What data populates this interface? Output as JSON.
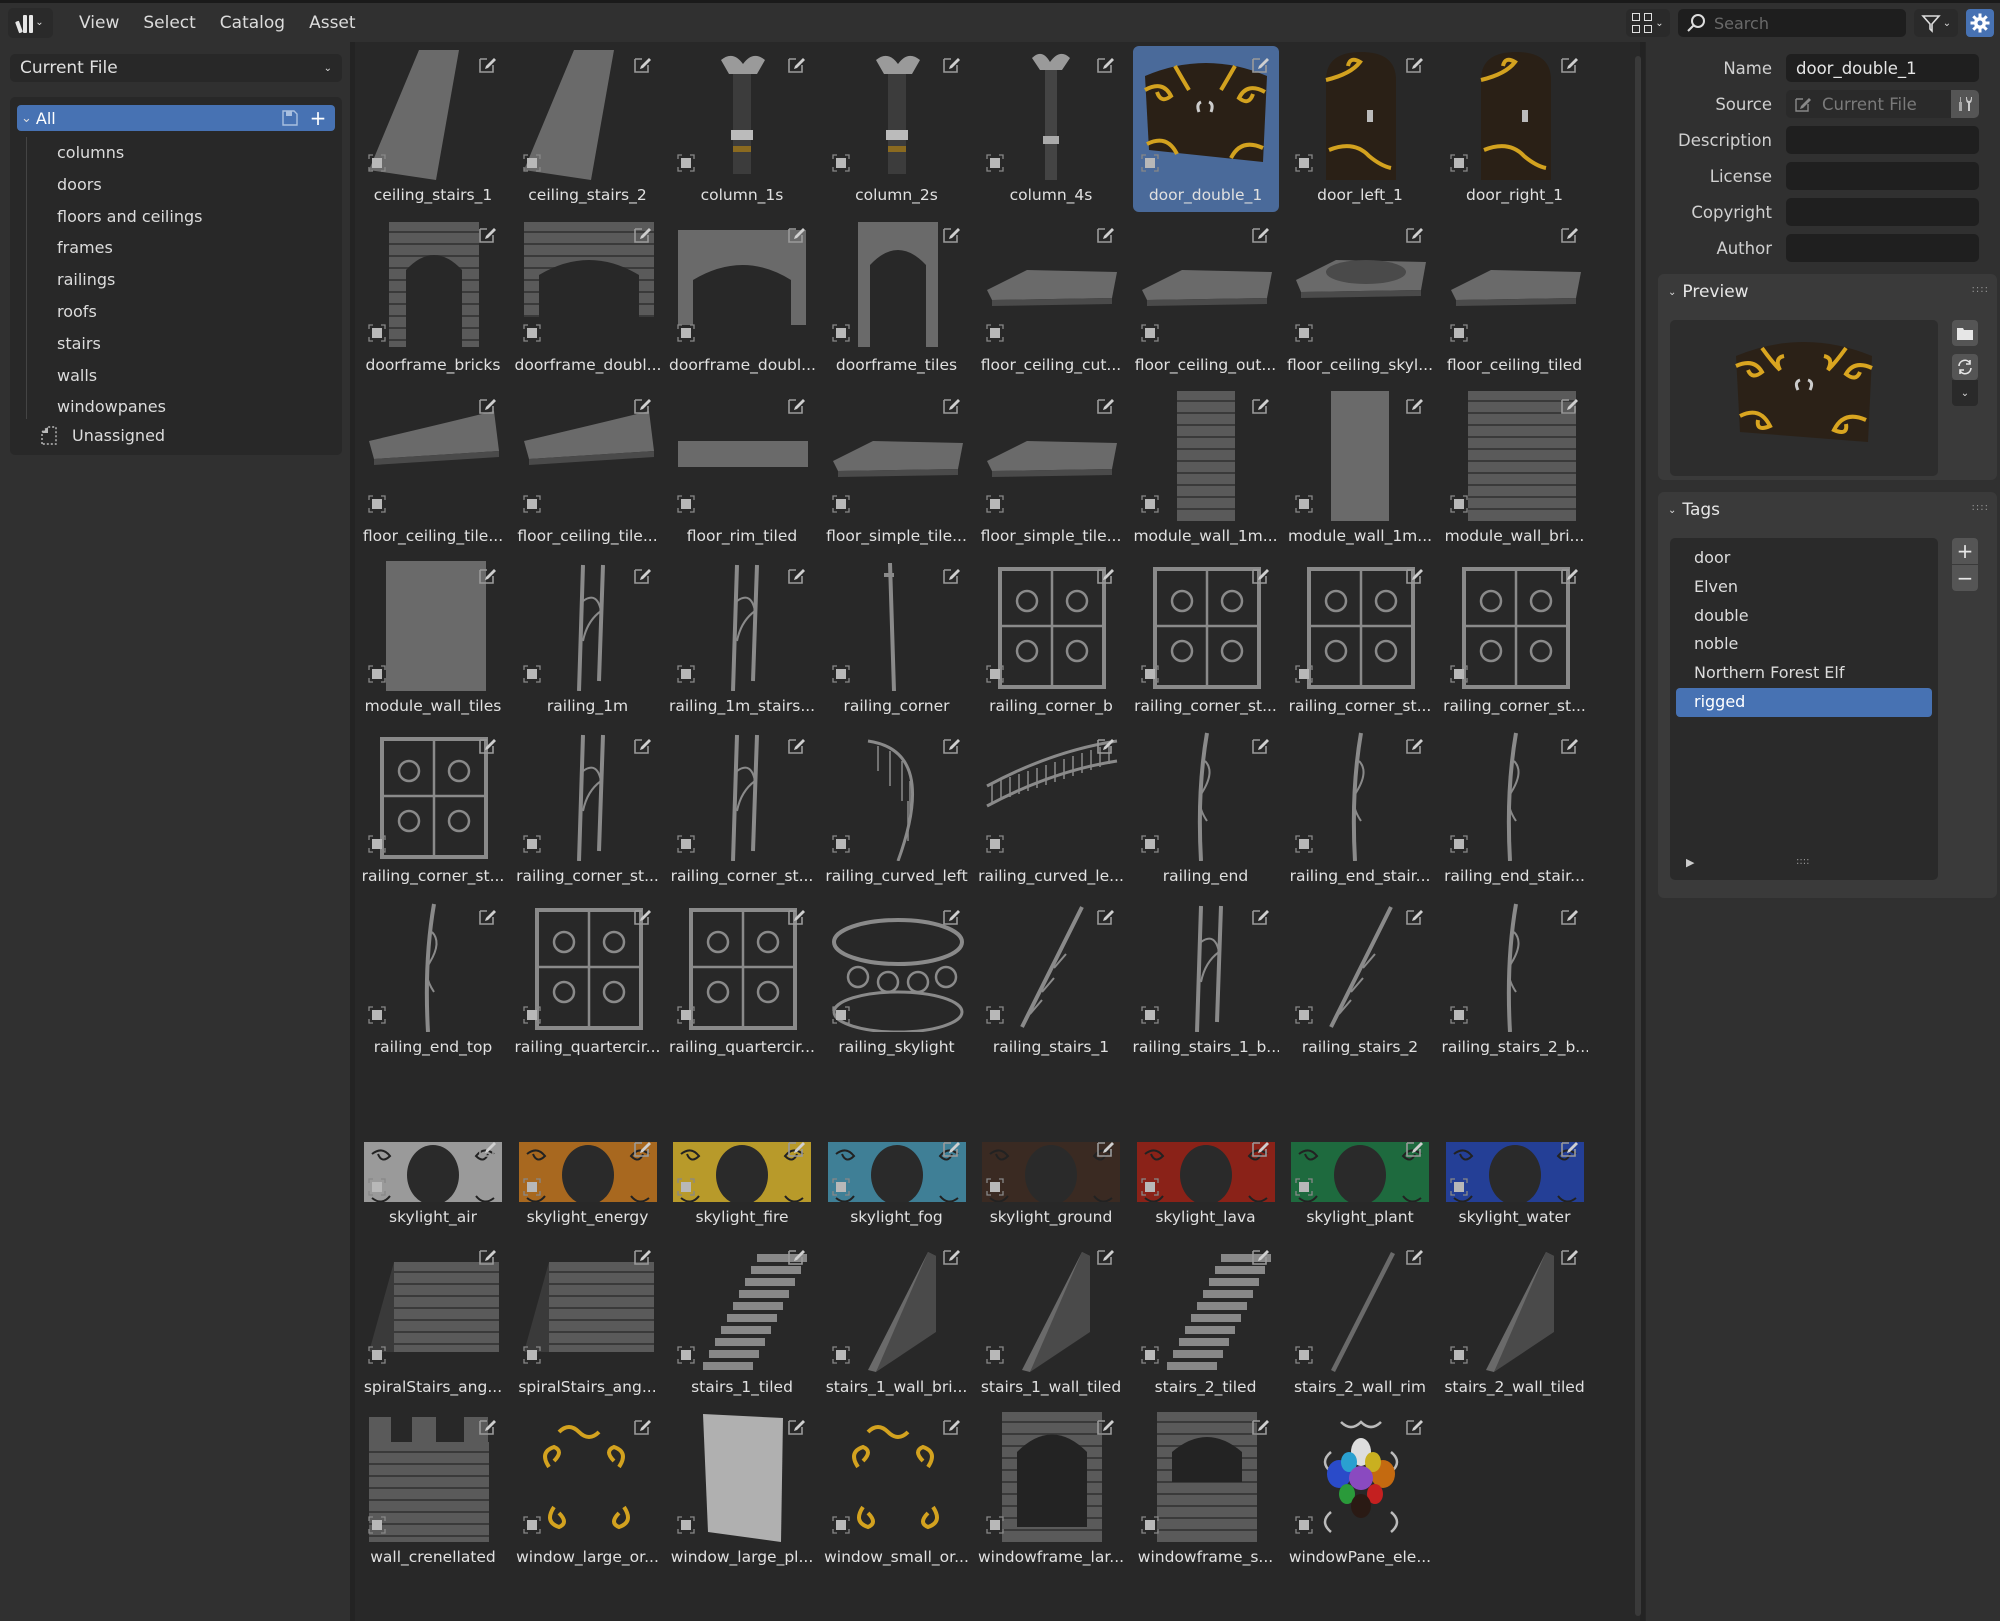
{
  "header": {
    "editor_icon": "asset-browser-icon",
    "menus": [
      "View",
      "Select",
      "Catalog",
      "Asset"
    ],
    "search_placeholder": "Search",
    "search_value": "",
    "display_icon": "thumbnail-grid-icon",
    "filter_icon": "filter-icon",
    "settings_icon": "gear-icon",
    "accent_color": "#4772b3"
  },
  "sidebar": {
    "library": "Current File",
    "root": "All",
    "catalogs": [
      "columns",
      "doors",
      "floors and ceilings",
      "frames",
      "railings",
      "roofs",
      "stairs",
      "walls",
      "windowpanes"
    ],
    "unassigned": "Unassigned"
  },
  "grid": {
    "selected": "door_double_1",
    "assets": [
      {
        "label": "ceiling_stairs_1",
        "kind": "slab-tilt"
      },
      {
        "label": "ceiling_stairs_2",
        "kind": "slab-tilt"
      },
      {
        "label": "column_1s",
        "kind": "column"
      },
      {
        "label": "column_2s",
        "kind": "column"
      },
      {
        "label": "column_4s",
        "kind": "column-thin"
      },
      {
        "label": "door_double_1",
        "kind": "door-double"
      },
      {
        "label": "door_left_1",
        "kind": "door-single"
      },
      {
        "label": "door_right_1",
        "kind": "door-single"
      },
      {
        "label": "doorframe_bricks",
        "kind": "doorframe"
      },
      {
        "label": "doorframe_doubl...",
        "kind": "doorframe-wide"
      },
      {
        "label": "doorframe_doubl...",
        "kind": "doorframe-wide-plain"
      },
      {
        "label": "doorframe_tiles",
        "kind": "doorframe-plain"
      },
      {
        "label": "floor_ceiling_cut...",
        "kind": "floor"
      },
      {
        "label": "floor_ceiling_out...",
        "kind": "floor"
      },
      {
        "label": "floor_ceiling_skyl...",
        "kind": "floor-hole"
      },
      {
        "label": "floor_ceiling_tiled",
        "kind": "floor"
      },
      {
        "label": "floor_ceiling_tile...",
        "kind": "floor-curve"
      },
      {
        "label": "floor_ceiling_tile...",
        "kind": "floor-curve"
      },
      {
        "label": "floor_rim_tiled",
        "kind": "floor-rim"
      },
      {
        "label": "floor_simple_tile...",
        "kind": "floor"
      },
      {
        "label": "floor_simple_tile...",
        "kind": "floor"
      },
      {
        "label": "module_wall_1m...",
        "kind": "wall-narrow-brick"
      },
      {
        "label": "module_wall_1m...",
        "kind": "wall-narrow"
      },
      {
        "label": "module_wall_bri...",
        "kind": "wall-brick"
      },
      {
        "label": "module_wall_tiles",
        "kind": "wall"
      },
      {
        "label": "railing_1m",
        "kind": "railing-post"
      },
      {
        "label": "railing_1m_stairs...",
        "kind": "railing-post"
      },
      {
        "label": "railing_corner",
        "kind": "railing-pole"
      },
      {
        "label": "railing_corner_b",
        "kind": "railing-ornate"
      },
      {
        "label": "railing_corner_st...",
        "kind": "railing-ornate"
      },
      {
        "label": "railing_corner_st...",
        "kind": "railing-ornate"
      },
      {
        "label": "railing_corner_st...",
        "kind": "railing-ornate"
      },
      {
        "label": "railing_corner_st...",
        "kind": "railing-ornate"
      },
      {
        "label": "railing_corner_st...",
        "kind": "railing-post"
      },
      {
        "label": "railing_corner_st...",
        "kind": "railing-post"
      },
      {
        "label": "railing_curved_left",
        "kind": "railing-curve"
      },
      {
        "label": "railing_curved_le...",
        "kind": "railing-arc"
      },
      {
        "label": "railing_end",
        "kind": "railing-end"
      },
      {
        "label": "railing_end_stair...",
        "kind": "railing-end"
      },
      {
        "label": "railing_end_stair...",
        "kind": "railing-end"
      },
      {
        "label": "railing_end_top",
        "kind": "railing-end"
      },
      {
        "label": "railing_quartercir...",
        "kind": "railing-ornate"
      },
      {
        "label": "railing_quartercir...",
        "kind": "railing-ornate"
      },
      {
        "label": "railing_skylight",
        "kind": "railing-round"
      },
      {
        "label": "railing_stairs_1",
        "kind": "railing-diag"
      },
      {
        "label": "railing_stairs_1_b...",
        "kind": "railing-post"
      },
      {
        "label": "railing_stairs_2",
        "kind": "railing-diag"
      },
      {
        "label": "railing_stairs_2_b...",
        "kind": "railing-end"
      },
      {
        "label": "skylight_air",
        "kind": "skylight",
        "color": "#9a9a9a"
      },
      {
        "label": "skylight_energy",
        "kind": "skylight",
        "color": "#a8681f"
      },
      {
        "label": "skylight_fire",
        "kind": "skylight",
        "color": "#b89a2a"
      },
      {
        "label": "skylight_fog",
        "kind": "skylight",
        "color": "#3f7f96"
      },
      {
        "label": "skylight_ground",
        "kind": "skylight",
        "color": "#3a2a22"
      },
      {
        "label": "skylight_lava",
        "kind": "skylight",
        "color": "#8a2218"
      },
      {
        "label": "skylight_plant",
        "kind": "skylight",
        "color": "#1e6a3e"
      },
      {
        "label": "skylight_water",
        "kind": "skylight",
        "color": "#243f96"
      },
      {
        "label": "spiralStairs_ang...",
        "kind": "stairs-brick"
      },
      {
        "label": "spiralStairs_ang...",
        "kind": "stairs-brick"
      },
      {
        "label": "stairs_1_tiled",
        "kind": "stairs"
      },
      {
        "label": "stairs_1_wall_bri...",
        "kind": "stairs-wall"
      },
      {
        "label": "stairs_1_wall_tiled",
        "kind": "stairs-wall"
      },
      {
        "label": "stairs_2_tiled",
        "kind": "stairs"
      },
      {
        "label": "stairs_2_wall_rim",
        "kind": "stairs-wall-thin"
      },
      {
        "label": "stairs_2_wall_tiled",
        "kind": "stairs-wall"
      },
      {
        "label": "wall_crenellated",
        "kind": "wall-crenel"
      },
      {
        "label": "window_large_or...",
        "kind": "ornament-gold"
      },
      {
        "label": "window_large_pl...",
        "kind": "pane-plain"
      },
      {
        "label": "window_small_or...",
        "kind": "ornament-gold"
      },
      {
        "label": "windowframe_lar...",
        "kind": "windowframe"
      },
      {
        "label": "windowframe_s...",
        "kind": "windowframe-small"
      },
      {
        "label": "windowPane_ele...",
        "kind": "pane-elements"
      }
    ]
  },
  "details": {
    "fields": [
      {
        "label": "Name",
        "value": "door_double_1"
      },
      {
        "label": "Source",
        "value": "Current File"
      },
      {
        "label": "Description",
        "value": ""
      },
      {
        "label": "License",
        "value": ""
      },
      {
        "label": "Copyright",
        "value": ""
      },
      {
        "label": "Author",
        "value": ""
      }
    ],
    "preview_title": "Preview",
    "tags_title": "Tags",
    "tags": [
      "door",
      "Elven",
      "double",
      "noble",
      "Northern Forest Elf",
      "rigged"
    ],
    "selected_tag": "rigged"
  }
}
